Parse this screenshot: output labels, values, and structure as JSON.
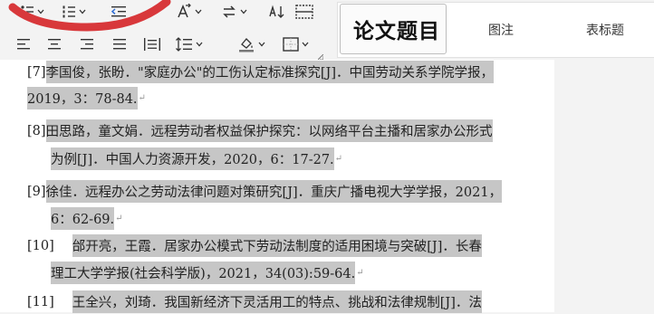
{
  "ribbon": {
    "styles": {
      "current": "论文题目",
      "items": [
        "图注",
        "表标题"
      ]
    },
    "icons": {
      "bullets": "bullet-list-icon",
      "numbering": "numbered-list-icon",
      "decrease_indent": "decrease-indent-icon",
      "increase_indent": "increase-indent-icon",
      "text_direction": "text-direction-icon",
      "replace": "replace-icon",
      "sort": "sort-icon",
      "borders_cells": "cell-borders-icon",
      "align_left": "align-left-icon",
      "align_center": "align-center-icon",
      "align_right": "align-right-icon",
      "justify": "justify-icon",
      "distributed": "distributed-icon",
      "line_spacing": "line-spacing-icon",
      "shading": "shading-icon",
      "borders": "borders-icon"
    },
    "accent": "#d8383b"
  },
  "document": {
    "refs": [
      {
        "num": "[7]",
        "lines": [
          "李国俊，张盼．\"家庭办公\"的工伤认定标准探究[J]．中国劳动关系学院学报，",
          "2019，3：78-84."
        ]
      },
      {
        "num": "[8]",
        "lines": [
          "田思路，童文娟．远程劳动者权益保护探究：以网络平台主播和居家办公形式",
          "为例[J]．中国人力资源开发，2020，6：17-27."
        ]
      },
      {
        "num": "[9]",
        "lines": [
          "徐佳．远程办公之劳动法律问题对策研究[J]．重庆广播电视大学学报，2021，",
          "6：62-69."
        ]
      },
      {
        "num": "[10]",
        "lines": [
          "邰开亮，王霞．居家办公模式下劳动法制度的适用困境与突破[J]．长春",
          "理工大学学报(社会科学版)，2021，34(03):59-64."
        ]
      },
      {
        "num": "[11]",
        "lines": [
          "王全兴，刘琦．我国新经济下灵活用工的特点、挑战和法律规制[J]．法"
        ]
      }
    ],
    "highlight_color": "#c6c6c6"
  }
}
